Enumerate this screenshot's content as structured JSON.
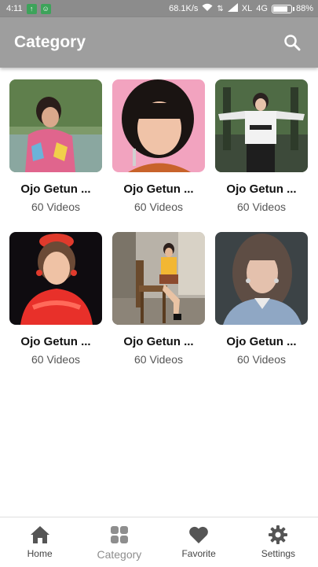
{
  "status_bar": {
    "time": "4:11",
    "speed": "68.1K/s",
    "carrier": "XL",
    "network": "4G",
    "battery": "88%",
    "battery_level": 0.88
  },
  "app_bar": {
    "title": "Category",
    "search_icon": "search-icon"
  },
  "categories": [
    {
      "title": "Ojo Getun ...",
      "count": "60 Videos"
    },
    {
      "title": "Ojo Getun ...",
      "count": "60 Videos"
    },
    {
      "title": "Ojo Getun ...",
      "count": "60 Videos"
    },
    {
      "title": "Ojo Getun ...",
      "count": "60 Videos"
    },
    {
      "title": "Ojo Getun ...",
      "count": "60 Videos"
    },
    {
      "title": "Ojo Getun ...",
      "count": "60 Videos"
    }
  ],
  "bottom_nav": {
    "items": [
      {
        "label": "Home",
        "icon": "home-icon"
      },
      {
        "label": "Category",
        "icon": "grid-icon"
      },
      {
        "label": "Favorite",
        "icon": "heart-icon"
      },
      {
        "label": "Settings",
        "icon": "gear-icon"
      }
    ],
    "active": "Category"
  },
  "colors": {
    "app_bar": "#9e9e9e",
    "status_bar": "#8c8c8c",
    "nav_icon": "#555555",
    "nav_active_icon": "#8e8e8e"
  }
}
